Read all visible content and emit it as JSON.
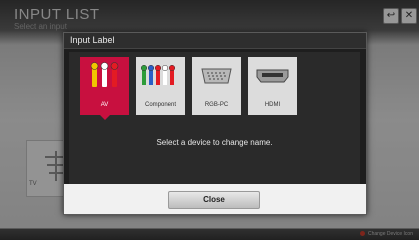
{
  "page": {
    "title": "INPUT LIST",
    "subtitle": "Select an input",
    "back_icon": "back-arrow-icon",
    "close_icon": "close-x-icon",
    "back_symbol": "↩",
    "close_symbol": "✕",
    "bottom_hint": "Change Device Icon",
    "card_label": "TV"
  },
  "dialog": {
    "title": "Input Label",
    "tiles": [
      {
        "label": "AV",
        "icon": "rca-av-cable-icon",
        "selected": true
      },
      {
        "label": "Component",
        "icon": "component-cable-icon",
        "selected": false
      },
      {
        "label": "RGB-PC",
        "icon": "vga-port-icon",
        "selected": false
      },
      {
        "label": "HDMI",
        "icon": "hdmi-port-icon",
        "selected": false
      }
    ],
    "instruction": "Select a device to change name.",
    "close_label": "Close"
  },
  "colors": {
    "accent": "#c8103f",
    "dialog_bg": "#1e1e1e",
    "tile_bg": "#dcdcdc"
  }
}
